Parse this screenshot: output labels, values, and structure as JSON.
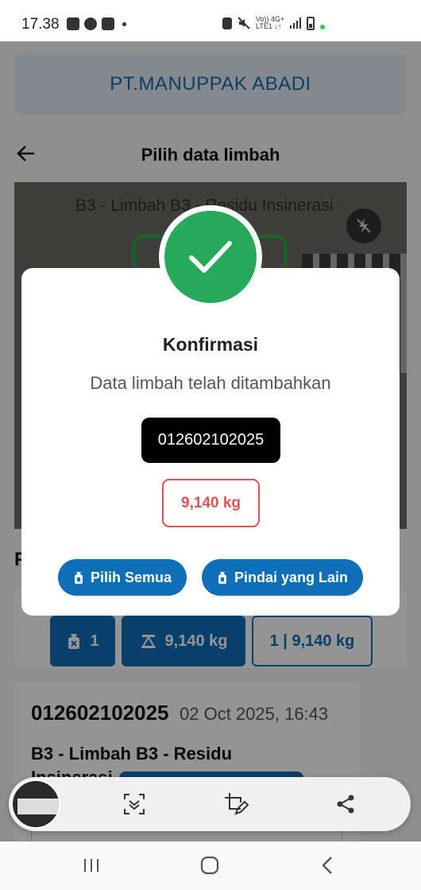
{
  "status_bar": {
    "time": "17.38",
    "network_top": "Vo)) 4G+",
    "network_bottom": "LTE1 ↓↑",
    "icons": [
      "gallery-icon",
      "whatsapp-icon",
      "teams-icon",
      "dot-icon",
      "battery-saver-icon",
      "mute-icon",
      "signal-icon",
      "battery-icon"
    ]
  },
  "app": {
    "company": "PT.MANUPPAK ABADI",
    "title": "Pilih data limbah",
    "scanner_label": "B3 - Limbah B3 - Residu Insinerasi",
    "section_heading_partial": "F",
    "summary": {
      "count": "1",
      "total_weight": "9,140 kg",
      "selected": "1 | 9,140 kg"
    },
    "record": {
      "code": "012602102025",
      "date": "02 Oct 2025, 16:43",
      "type": "B3 - Limbah B3 - Residu Insinerasi"
    }
  },
  "dialog": {
    "title": "Konfirmasi",
    "message": "Data limbah telah ditambahkan",
    "code": "012602102025",
    "weight": "9,140 kg",
    "select_all_label": "Pilih Semua",
    "scan_other_label": "Pindai yang Lain"
  },
  "colors": {
    "primary": "#0d6fb8",
    "success": "#27a95a",
    "danger": "#e05252"
  }
}
